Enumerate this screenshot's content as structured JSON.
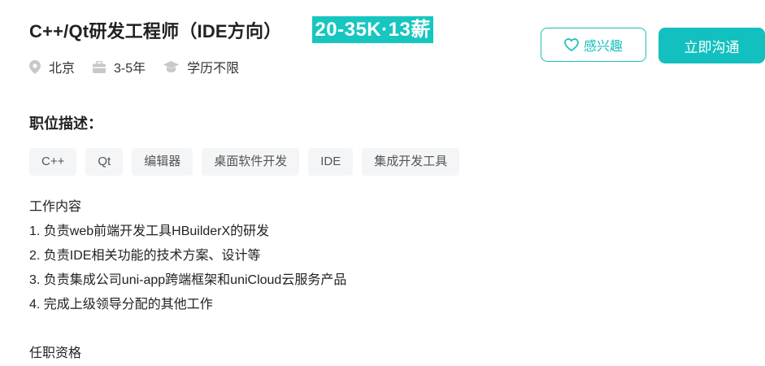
{
  "job": {
    "title": "C++/Qt研发工程师（IDE方向）",
    "salary": "20-35K·13薪"
  },
  "meta": {
    "location": "北京",
    "experience": "3-5年",
    "education": "学历不限"
  },
  "actions": {
    "interest_label": "感兴趣",
    "chat_label": "立即沟通"
  },
  "description": {
    "section_title": "职位描述：",
    "tags": [
      "C++",
      "Qt",
      "编辑器",
      "桌面软件开发",
      "IDE",
      "集成开发工具"
    ],
    "lines": [
      "工作内容",
      "1. 负责web前端开发工具HBuilderX的研发",
      "2. 负责IDE相关功能的技术方案、设计等",
      "3. 负责集成公司uni-app跨端框架和uniCloud云服务产品",
      "4. 完成上级领导分配的其他工作",
      "",
      "任职资格"
    ]
  },
  "colors": {
    "accent": "#18c6c0",
    "tag_bg": "#f4f5f7",
    "icon_gray": "#c8c8c8"
  },
  "icons": [
    "location-pin-icon",
    "briefcase-icon",
    "graduation-cap-icon",
    "heart-icon"
  ]
}
